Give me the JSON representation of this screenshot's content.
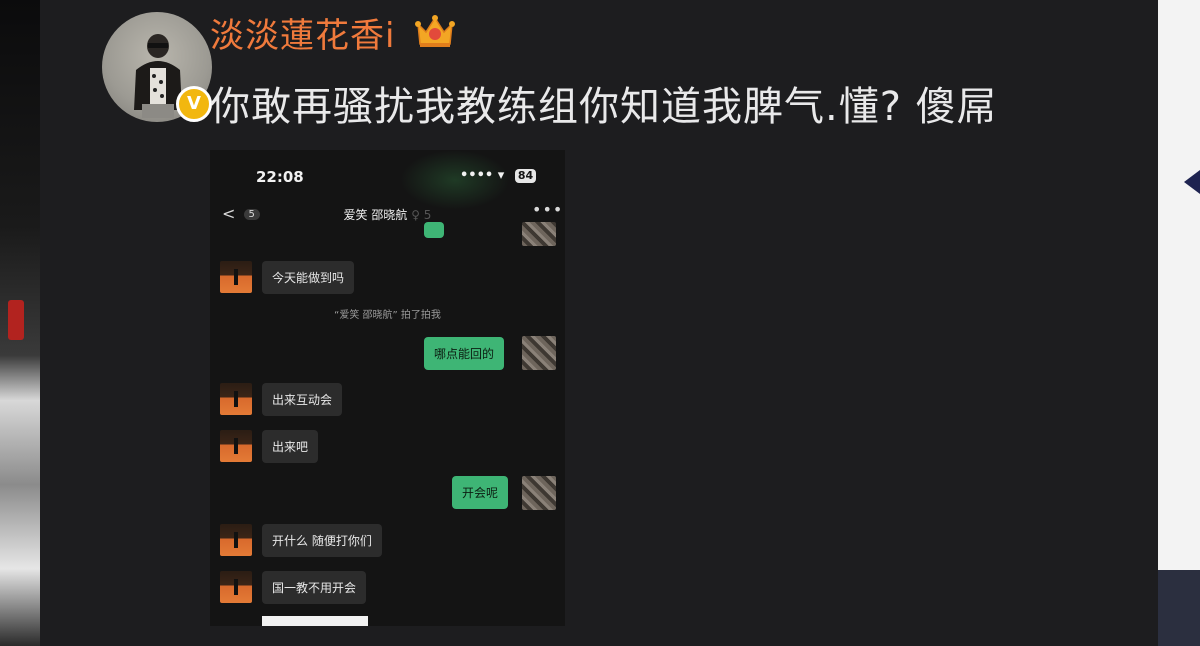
{
  "post": {
    "username": "淡淡蓮花香i",
    "text": "你敢再骚扰我教练组你知道我脾气.懂? 傻屌",
    "verified_badge": "V",
    "crown_icon": "crown-icon"
  },
  "screenshot": {
    "status_time": "22:08",
    "status_icons": "•••• ▾",
    "battery": "84",
    "back_label": "<",
    "unread_count": "5",
    "chat_title": "爱笑 邵晓航",
    "chat_title_faint": "♀ 5",
    "more_label": "•••",
    "system_note": "“爱笑 邵晓航” 拍了拍我",
    "messages": [
      {
        "side": "in",
        "text": "今天能做到吗"
      },
      {
        "side": "out",
        "text": "哪点能回的"
      },
      {
        "side": "in",
        "text": "出来互动会"
      },
      {
        "side": "in",
        "text": "出来吧"
      },
      {
        "side": "out",
        "text": "开会呢"
      },
      {
        "side": "in",
        "text": "开什么 随便打你们"
      },
      {
        "side": "in",
        "text": "国一教不用开会"
      }
    ]
  },
  "colors": {
    "username": "#f07a3c",
    "verified": "#f2b70f",
    "bubble_out": "#3eb575",
    "bubble_in": "#2c2c2c"
  }
}
